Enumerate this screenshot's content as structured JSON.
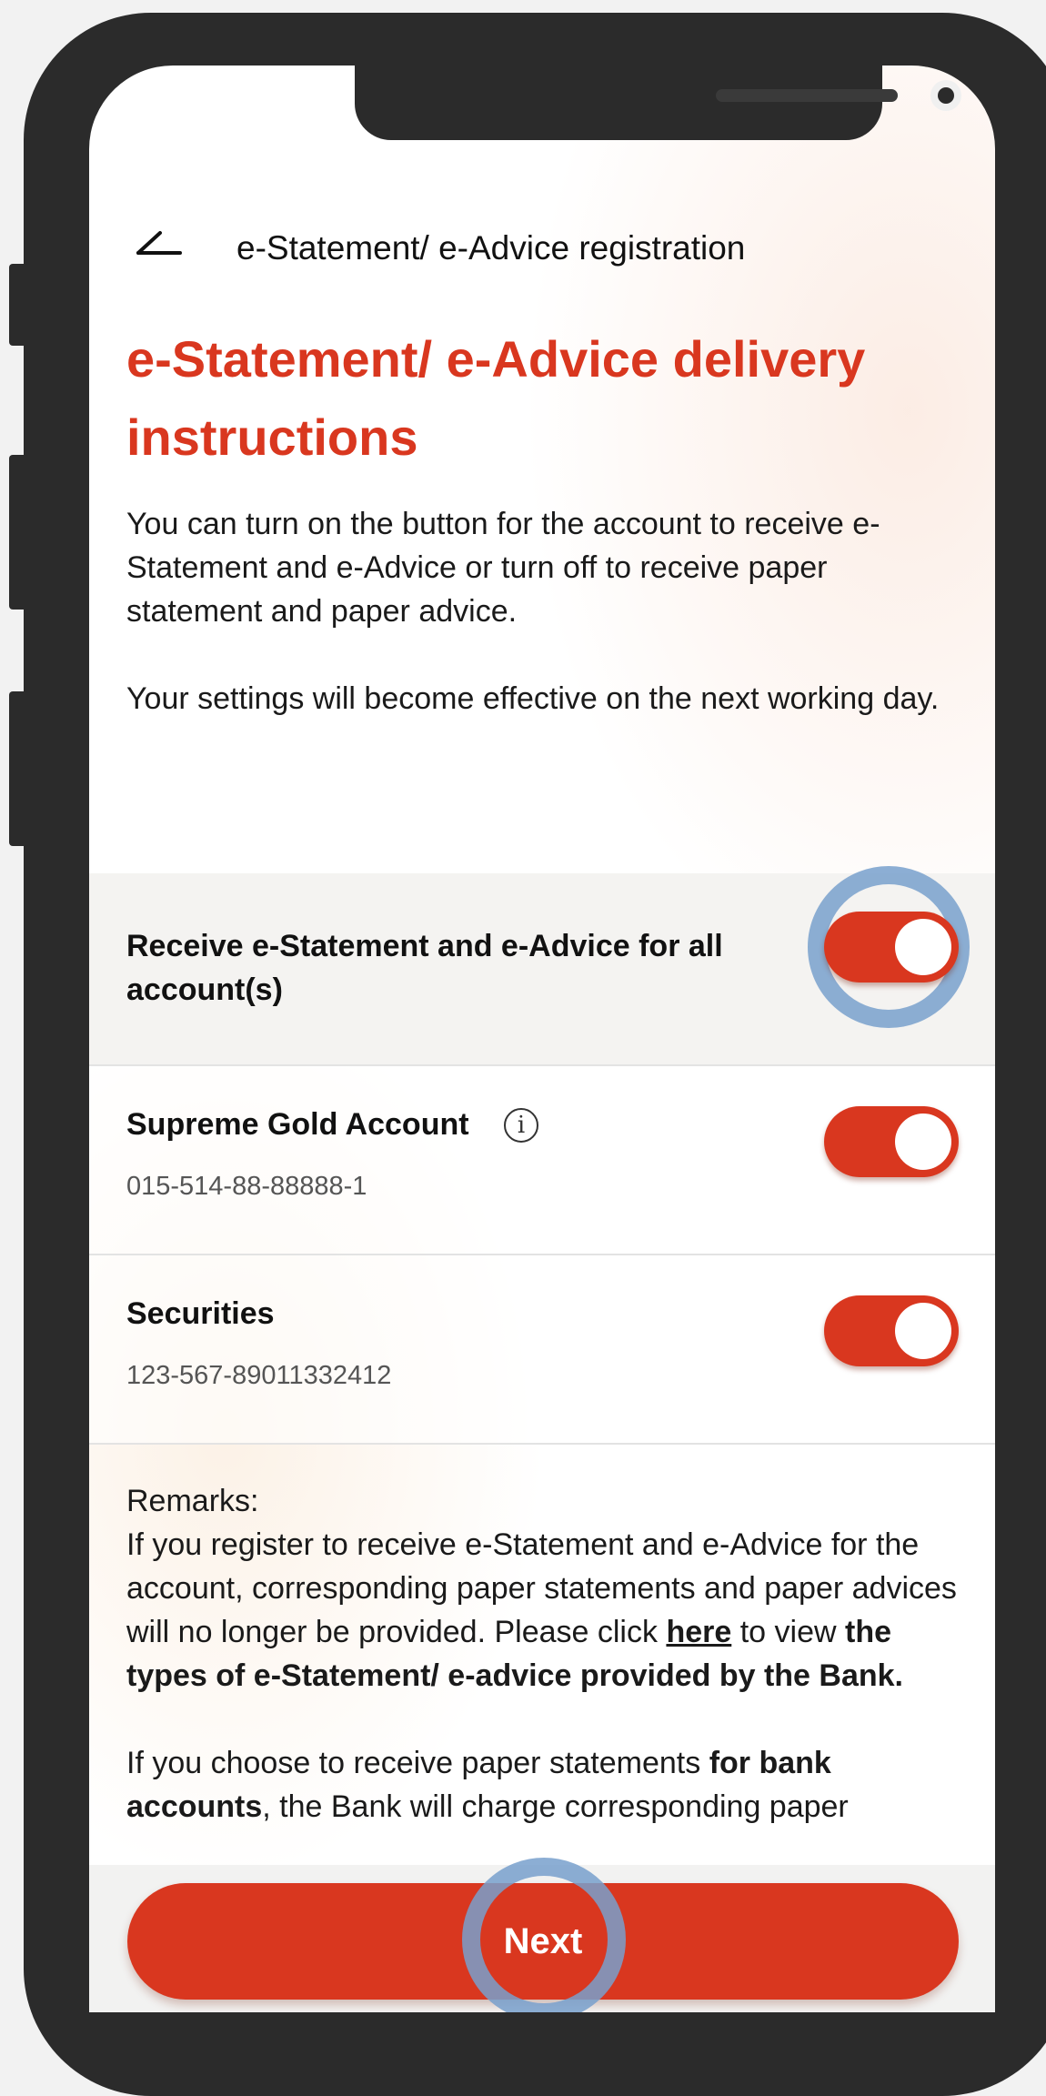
{
  "header": {
    "back_icon": "back-arrow-icon",
    "title": "e-Statement/ e-Advice registration"
  },
  "page_title": "e-Statement/ e-Advice delivery instructions",
  "intro": {
    "p1": "You can turn on the button for the account to receive e-Statement and e-Advice or turn off to receive paper statement and paper advice.",
    "p2": "Your settings will become effective on the next working day."
  },
  "all_accounts": {
    "label": "Receive e-Statement and e-Advice for all account(s)",
    "enabled": true
  },
  "accounts": [
    {
      "name": "Supreme Gold Account",
      "number": "015-514-88-88888-1",
      "has_info": true,
      "enabled": true
    },
    {
      "name": "Securities",
      "number": "123-567-89011332412",
      "has_info": false,
      "enabled": true
    }
  ],
  "remarks": {
    "heading": "Remarks:",
    "p1_a": "If you register to receive e-Statement and e-Advice for the account, corresponding paper statements and paper advices will no longer be provided. Please click",
    "p1_link": "here",
    "p1_b": "to view",
    "p1_bold": "the types of e-Statement/ e-advice provided by the Bank.",
    "p2_a": "If you choose to receive paper statements",
    "p2_bold": "for bank accounts",
    "p2_b": ", the Bank will charge corresponding paper"
  },
  "next_button": {
    "label": "Next"
  },
  "colors": {
    "accent": "#d9371f",
    "focus_ring": "#78a0cd"
  }
}
